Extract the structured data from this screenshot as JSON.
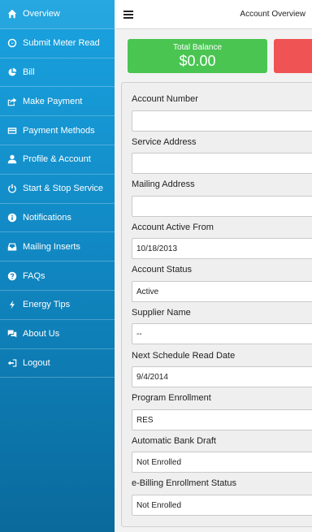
{
  "sidebar": {
    "items": [
      {
        "label": "Overview",
        "icon": "home-icon"
      },
      {
        "label": "Submit Meter Read",
        "icon": "meter-icon"
      },
      {
        "label": "Bill",
        "icon": "pie-chart-icon"
      },
      {
        "label": "Make Payment",
        "icon": "share-icon"
      },
      {
        "label": "Payment Methods",
        "icon": "credit-card-icon"
      },
      {
        "label": "Profile & Account",
        "icon": "user-icon"
      },
      {
        "label": "Start & Stop Service",
        "icon": "power-icon"
      },
      {
        "label": "Notifications",
        "icon": "info-icon"
      },
      {
        "label": "Mailing Inserts",
        "icon": "inbox-icon"
      },
      {
        "label": "FAQs",
        "icon": "question-icon"
      },
      {
        "label": "Energy Tips",
        "icon": "bolt-icon"
      },
      {
        "label": "About Us",
        "icon": "chat-icon"
      },
      {
        "label": "Logout",
        "icon": "logout-icon"
      }
    ]
  },
  "topbar": {
    "title": "Account Overview"
  },
  "balance": {
    "label": "Total Balance",
    "value": "$0.00"
  },
  "colors": {
    "sidebar": "#1189c4",
    "balance": "#4ac552",
    "alert": "#f05353"
  },
  "fields": [
    {
      "label": "Account Number",
      "value": ""
    },
    {
      "label": "Service Address",
      "value": ""
    },
    {
      "label": "Mailing Address",
      "value": ""
    },
    {
      "label": "Account Active From",
      "value": "10/18/2013"
    },
    {
      "label": "Account Status",
      "value": "Active"
    },
    {
      "label": "Supplier Name",
      "value": "--"
    },
    {
      "label": "Next Schedule Read Date",
      "value": "9/4/2014"
    },
    {
      "label": "Program Enrollment",
      "value": "RES"
    },
    {
      "label": "Automatic Bank Draft",
      "value": "Not Enrolled"
    },
    {
      "label": "e-Billing Enrollment Status",
      "value": "Not Enrolled"
    }
  ]
}
